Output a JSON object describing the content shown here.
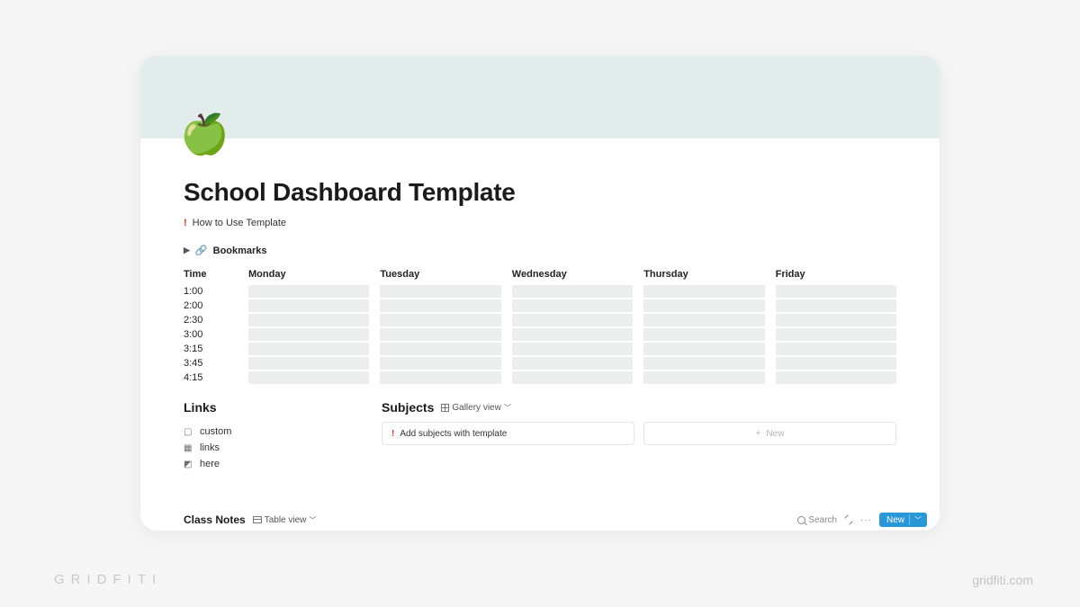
{
  "page": {
    "icon": "🍏",
    "title": "School Dashboard Template",
    "howto_label": "How to Use Template",
    "bookmarks_label": "Bookmarks"
  },
  "schedule": {
    "time_header": "Time",
    "days": [
      "Monday",
      "Tuesday",
      "Wednesday",
      "Thursday",
      "Friday"
    ],
    "times": [
      "1:00",
      "2:00",
      "2:30",
      "3:00",
      "3:15",
      "3:45",
      "4:15"
    ]
  },
  "links": {
    "heading": "Links",
    "items": [
      {
        "icon": "▢",
        "label": "custom"
      },
      {
        "icon": "▦",
        "label": "links"
      },
      {
        "icon": "◩",
        "label": "here"
      }
    ]
  },
  "subjects": {
    "heading": "Subjects",
    "view_label": "Gallery view",
    "add_label": "Add subjects with template",
    "new_label": "New"
  },
  "classnotes": {
    "heading": "Class Notes",
    "view_label": "Table view",
    "search_label": "Search",
    "new_label": "New"
  },
  "watermark": {
    "left": "GRIDFITI",
    "right": "gridfiti.com"
  }
}
